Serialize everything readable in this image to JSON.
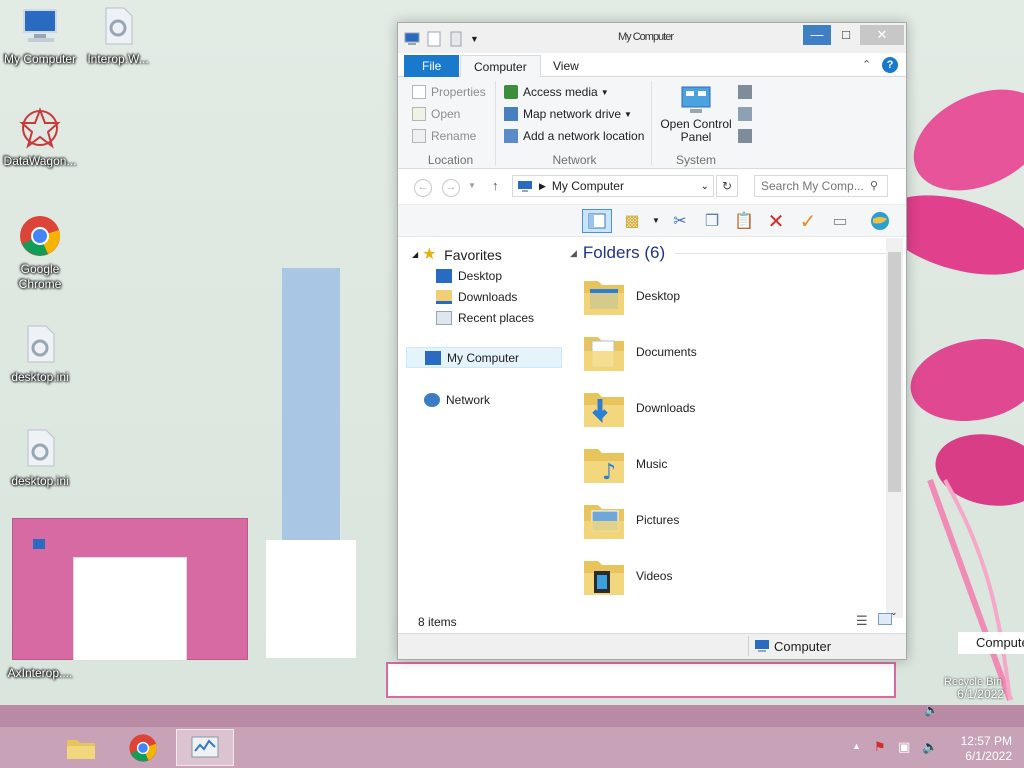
{
  "desktop": {
    "icons": [
      {
        "label": "My Computer"
      },
      {
        "label": "Interop.W..."
      },
      {
        "label": "DataWagon..."
      },
      {
        "label": "Google Chrome"
      },
      {
        "label": "desktop.ini"
      },
      {
        "label": "desktop.ini"
      },
      {
        "label": "AxInterop...."
      }
    ],
    "recycle_label": "Recycle Bin",
    "behind_computer": "Compute"
  },
  "window": {
    "title": "My Computer",
    "tabs": [
      "File",
      "Computer",
      "View"
    ],
    "help": "?",
    "ribbon": {
      "location": {
        "name": "Location",
        "items": [
          "Properties",
          "Open",
          "Rename"
        ]
      },
      "network": {
        "name": "Network",
        "items": [
          "Access media",
          "Map network drive",
          "Add a network location"
        ]
      },
      "system": {
        "name": "System",
        "open_cp": "Open Control Panel"
      }
    },
    "address": {
      "path": "My Computer",
      "search_placeholder": "Search My Comp..."
    },
    "nav": {
      "favorites": "Favorites",
      "fav_items": [
        "Desktop",
        "Downloads",
        "Recent places"
      ],
      "my_computer": "My Computer",
      "network": "Network"
    },
    "content": {
      "header": "Folders (6)",
      "folders": [
        "Desktop",
        "Documents",
        "Downloads",
        "Music",
        "Pictures",
        "Videos"
      ]
    },
    "status": {
      "items": "8 items",
      "location": "Computer"
    }
  },
  "taskbar": {
    "time": "12:57 PM",
    "date": "6/1/2022",
    "ghost_date": "6/1/2022"
  }
}
